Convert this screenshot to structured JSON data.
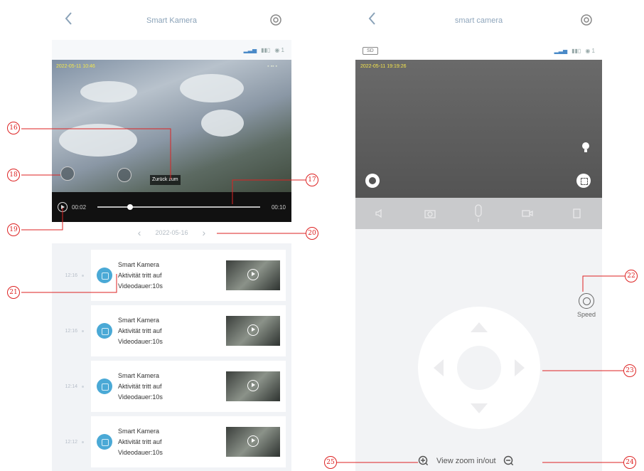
{
  "left": {
    "title": "Smart Kamera",
    "video_timestamp": "2022-05-11 10:46",
    "return_label": "Zurück zum",
    "time_current": "00:02",
    "time_total": "00:10",
    "date": "2022-05-16",
    "events": [
      {
        "time": "12:16",
        "line1": "Smart Kamera",
        "line2": "Aktivität tritt auf",
        "line3": "Videodauer:10s"
      },
      {
        "time": "12:16",
        "line1": "Smart Kamera",
        "line2": "Aktivität tritt auf",
        "line3": "Videodauer:10s"
      },
      {
        "time": "12:14",
        "line1": "Smart Kamera",
        "line2": "Aktivität tritt auf",
        "line3": "Videodauer:10s"
      },
      {
        "time": "12:12",
        "line1": "Smart Kamera",
        "line2": "Aktivität tritt auf",
        "line3": "Videodauer:10s"
      }
    ]
  },
  "right": {
    "title": "smart camera",
    "sd_label": "SD",
    "live_timestamp": "2022-05-11 19:19:26",
    "speed_label": "Speed",
    "zoom_label": "View zoom in/out"
  },
  "callouts": [
    "16",
    "17",
    "18",
    "19",
    "20",
    "21",
    "22",
    "23",
    "24",
    "25"
  ],
  "colors": {
    "accent_red": "#d22222",
    "badge_blue": "#4aa9d6"
  }
}
